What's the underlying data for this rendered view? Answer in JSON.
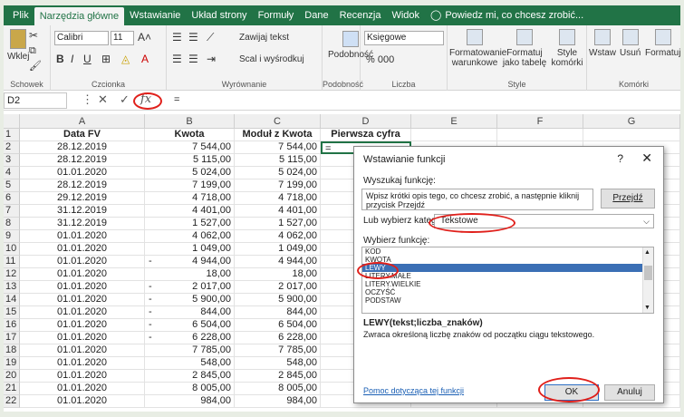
{
  "tabs": [
    "Plik",
    "Narzędzia główne",
    "Wstawianie",
    "Układ strony",
    "Formuły",
    "Dane",
    "Recenzja",
    "Widok"
  ],
  "tell": "Powiedz mi, co chcesz zrobić...",
  "ribbon": {
    "paste": "Wklej",
    "clipboard": "Schowek",
    "font_name": "Calibri",
    "font_size": "11",
    "font_group": "Czcionka",
    "wrap": "Zawijaj tekst",
    "merge": "Scal i wyśrodkuj",
    "align_group": "Wyrównanie",
    "similar": "Podobność",
    "similar_group": "Podobność",
    "numfmt": "Księgowe",
    "pct": "% 000",
    "number_group": "Liczba",
    "cond": "Formatowanie warunkowe",
    "table": "Formatuj jako tabelę",
    "styles": "Style komórki",
    "style_group": "Style",
    "insert": "Wstaw",
    "delete": "Usuń",
    "format": "Formatuj",
    "cells_group": "Komórki"
  },
  "formula": {
    "namebox": "D2",
    "value": "="
  },
  "columns": [
    "A",
    "B",
    "C",
    "D",
    "E",
    "F",
    "G"
  ],
  "headers": [
    "Data FV",
    "Kwota",
    "Moduł z Kwota",
    "Pierwsza cyfra"
  ],
  "rows": [
    [
      "2",
      "28.12.2019",
      "",
      "7 544,00",
      "7 544,00",
      "="
    ],
    [
      "3",
      "28.12.2019",
      "",
      "5 115,00",
      "5 115,00",
      ""
    ],
    [
      "4",
      "01.01.2020",
      "",
      "5 024,00",
      "5 024,00",
      ""
    ],
    [
      "5",
      "28.12.2019",
      "",
      "7 199,00",
      "7 199,00",
      ""
    ],
    [
      "6",
      "29.12.2019",
      "",
      "4 718,00",
      "4 718,00",
      ""
    ],
    [
      "7",
      "31.12.2019",
      "",
      "4 401,00",
      "4 401,00",
      ""
    ],
    [
      "8",
      "31.12.2019",
      "",
      "1 527,00",
      "1 527,00",
      ""
    ],
    [
      "9",
      "01.01.2020",
      "",
      "4 062,00",
      "4 062,00",
      ""
    ],
    [
      "10",
      "01.01.2020",
      "",
      "1 049,00",
      "1 049,00",
      ""
    ],
    [
      "11",
      "01.01.2020",
      "-",
      "4 944,00",
      "4 944,00",
      ""
    ],
    [
      "12",
      "01.01.2020",
      "",
      "18,00",
      "18,00",
      ""
    ],
    [
      "13",
      "01.01.2020",
      "-",
      "2 017,00",
      "2 017,00",
      ""
    ],
    [
      "14",
      "01.01.2020",
      "-",
      "5 900,00",
      "5 900,00",
      ""
    ],
    [
      "15",
      "01.01.2020",
      "-",
      "844,00",
      "844,00",
      ""
    ],
    [
      "16",
      "01.01.2020",
      "-",
      "6 504,00",
      "6 504,00",
      ""
    ],
    [
      "17",
      "01.01.2020",
      "-",
      "6 228,00",
      "6 228,00",
      ""
    ],
    [
      "18",
      "01.01.2020",
      "",
      "7 785,00",
      "7 785,00",
      ""
    ],
    [
      "19",
      "01.01.2020",
      "",
      "548,00",
      "548,00",
      ""
    ],
    [
      "20",
      "01.01.2020",
      "",
      "2 845,00",
      "2 845,00",
      ""
    ],
    [
      "21",
      "01.01.2020",
      "",
      "8 005,00",
      "8 005,00",
      ""
    ],
    [
      "22",
      "01.01.2020",
      "",
      "984,00",
      "984,00",
      ""
    ]
  ],
  "dialog": {
    "title": "Wstawianie funkcji",
    "help": "?",
    "close": "✕",
    "search_label": "Wyszukaj funkcję:",
    "search_text": "Wpisz krótki opis tego, co chcesz zrobić, a następnie kliknij przycisk Przejdź",
    "go": "Przejdź",
    "category_label": "Lub wybierz kategorię:",
    "category": "Tekstowe",
    "select_label": "Wybierz funkcję:",
    "functions": [
      "KOD",
      "KWOTA",
      "LEWY",
      "LITERY.MAŁE",
      "LITERY.WIELKIE",
      "OCZYŚĆ",
      "PODSTAW"
    ],
    "selected": "LEWY",
    "syntax": "LEWY(tekst;liczba_znaków)",
    "desc": "Zwraca określoną liczbę znaków od początku ciągu tekstowego.",
    "link": "Pomoc dotycząca tej funkcji",
    "ok": "OK",
    "cancel": "Anuluj"
  }
}
